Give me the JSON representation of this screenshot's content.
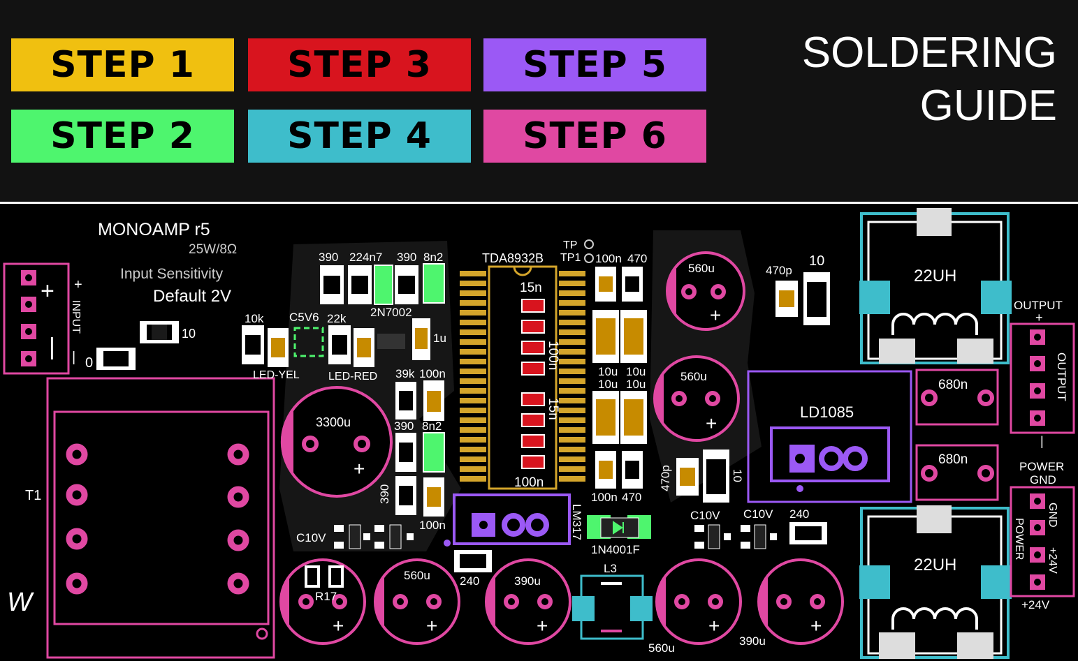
{
  "title": {
    "line1": "SOLDERING",
    "line2": "GUIDE"
  },
  "steps": [
    {
      "label": "STEP 1",
      "color": "#f0c010"
    },
    {
      "label": "STEP 2",
      "color": "#4ef56e"
    },
    {
      "label": "STEP 3",
      "color": "#d8141e"
    },
    {
      "label": "STEP 4",
      "color": "#3ebdcb"
    },
    {
      "label": "STEP 5",
      "color": "#9b59f5"
    },
    {
      "label": "STEP 6",
      "color": "#e048a2"
    }
  ],
  "board": {
    "name": "MONOAMP r5",
    "power": "25W/8Ω",
    "sensitivity_label": "Input Sensitivity",
    "sensitivity_value": "Default 2V",
    "transformer": "T1",
    "ic": "TDA8932B",
    "regulator": "LD1085",
    "lm": "LM317",
    "diode": "1N4001F",
    "inductor_small": "L3",
    "inductor_big": "22UH",
    "output_label": "OUTPUT",
    "power_label": "POWER",
    "gnd_label": "GND",
    "v24": "+24V",
    "input_label": "INPUT",
    "plus": "+",
    "minus": "–",
    "bar": "|",
    "tp": "TP",
    "tp1": "TP1",
    "led_yel": "LED-YEL",
    "led_red": "LED-RED",
    "transistor": "2N7002",
    "zener": "C5V6",
    "c10v": "C10V",
    "r17": "R17",
    "v390": "390",
    "v224": "224n7",
    "v8n2": "8n2",
    "v10k": "10k",
    "v22k": "22k",
    "v1u": "1u",
    "v39k": "39k",
    "v100n": "100n",
    "v470": "470",
    "v470p": "470p",
    "v10": "10",
    "v10u": "10u",
    "v15n": "15n",
    "v560u": "560u",
    "v3300u": "3300u",
    "v390u": "390u",
    "v680n": "680n",
    "v240": "240",
    "v0": "0",
    "logo": "W"
  }
}
